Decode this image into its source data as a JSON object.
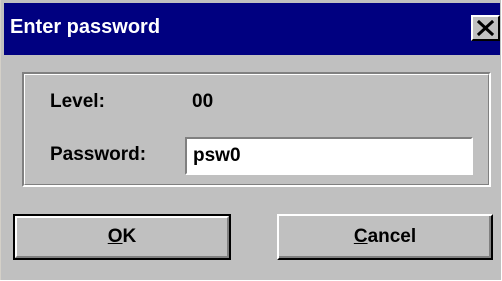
{
  "window": {
    "title": "Enter password",
    "close_icon": "close-icon"
  },
  "form": {
    "level_label": "Level:",
    "level_value": "00",
    "password_label": "Password:",
    "password_value": "psw0"
  },
  "buttons": {
    "ok": {
      "mnemonic": "O",
      "rest": "K"
    },
    "cancel": {
      "mnemonic": "C",
      "rest": "ancel"
    }
  },
  "colors": {
    "titlebar": "#000080",
    "face": "#c0c0c0",
    "field": "#ffffff"
  }
}
